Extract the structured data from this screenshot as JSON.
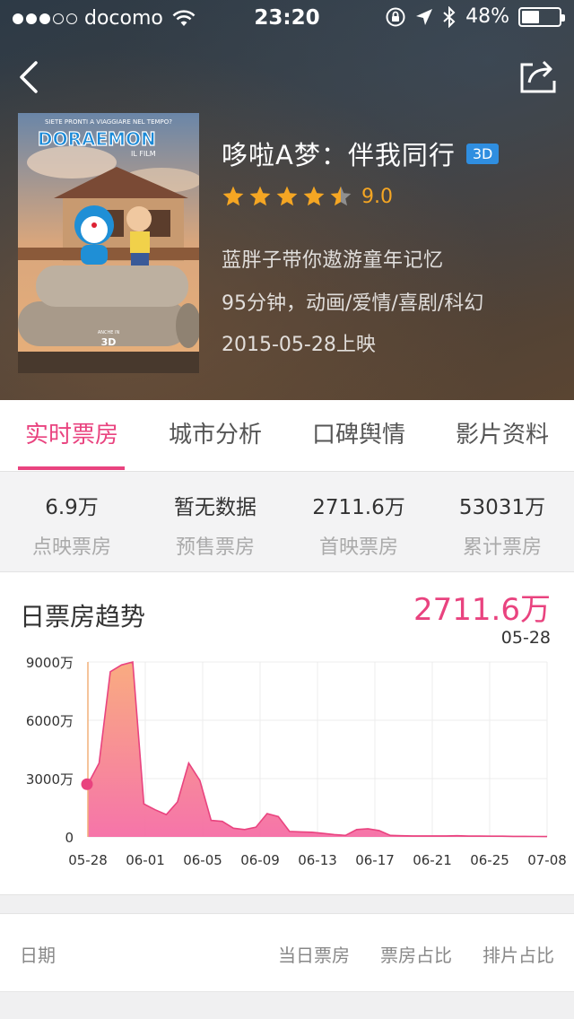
{
  "status_bar": {
    "carrier": "docomo",
    "time": "23:20",
    "battery": "48%",
    "battery_level": 0.48,
    "signal_bars": 3
  },
  "movie": {
    "title": "哆啦A梦：伴我同行",
    "badge": "3D",
    "rating": "9.0",
    "stars": 4.5,
    "tagline": "蓝胖子带你遨游童年记忆",
    "duration_genres": "95分钟，动画/爱情/喜剧/科幻",
    "release": "2015-05-28上映",
    "poster": {
      "top_text": "SIETE PRONTI A VIAGGIARE NEL TEMPO?",
      "logo": "DORAEMON",
      "logo_sub": "IL FILM",
      "bottom_small": "ANCHE IN",
      "bottom_3d": "3D"
    }
  },
  "tabs": [
    {
      "label": "实时票房",
      "active": true
    },
    {
      "label": "城市分析",
      "active": false
    },
    {
      "label": "口碑舆情",
      "active": false
    },
    {
      "label": "影片资料",
      "active": false
    }
  ],
  "stats": [
    {
      "value": "6.9万",
      "label": "点映票房"
    },
    {
      "value": "暂无数据",
      "label": "预售票房"
    },
    {
      "value": "2711.6万",
      "label": "首映票房"
    },
    {
      "value": "53031万",
      "label": "累计票房"
    }
  ],
  "chart": {
    "title": "日票房趋势",
    "highlight_value": "2711.6万",
    "highlight_date": "05-28"
  },
  "chart_data": {
    "type": "area",
    "title": "日票房趋势",
    "xlabel": "",
    "ylabel": "",
    "x_tick_labels": [
      "05-28",
      "06-01",
      "06-05",
      "06-09",
      "06-13",
      "06-17",
      "06-21",
      "06-25",
      "07-08"
    ],
    "y_tick_labels": [
      "9000万",
      "6000万",
      "3000万",
      "0"
    ],
    "ylim": [
      0,
      9000
    ],
    "y_ticks": [
      0,
      3000,
      6000,
      9000
    ],
    "unit": "万",
    "grid": true,
    "x_day_offsets": [
      0,
      1,
      2,
      3,
      4,
      5,
      6,
      7,
      8,
      9,
      10,
      11,
      12,
      13,
      14,
      15,
      16,
      17,
      18,
      19,
      20,
      21,
      22,
      23,
      24,
      25,
      26,
      27,
      28,
      29,
      30,
      31,
      32,
      33,
      34,
      35,
      36,
      37,
      38,
      39,
      40,
      41
    ],
    "values": [
      2712,
      3800,
      8500,
      8850,
      9000,
      1700,
      1400,
      1150,
      1800,
      3800,
      2900,
      850,
      800,
      450,
      380,
      500,
      1200,
      1050,
      280,
      260,
      240,
      180,
      120,
      80,
      380,
      420,
      330,
      80,
      60,
      50,
      50,
      50,
      50,
      60,
      40,
      40,
      35,
      35,
      30,
      30,
      25,
      20
    ],
    "highlight_index": 0
  },
  "table": {
    "headers": [
      "日期",
      "当日票房",
      "票房占比",
      "排片占比"
    ]
  },
  "colors": {
    "accent": "#e9437f",
    "star": "#f5a623",
    "badge": "#2f8ee0",
    "area_top": "#f9a77a",
    "area_bottom": "#f56da5"
  },
  "icons": {
    "back": "chevron-left-icon",
    "share": "share-icon",
    "wifi": "wifi-icon",
    "bluetooth": "bluetooth-icon",
    "location": "location-arrow-icon",
    "lock_rotation": "rotation-lock-icon"
  }
}
